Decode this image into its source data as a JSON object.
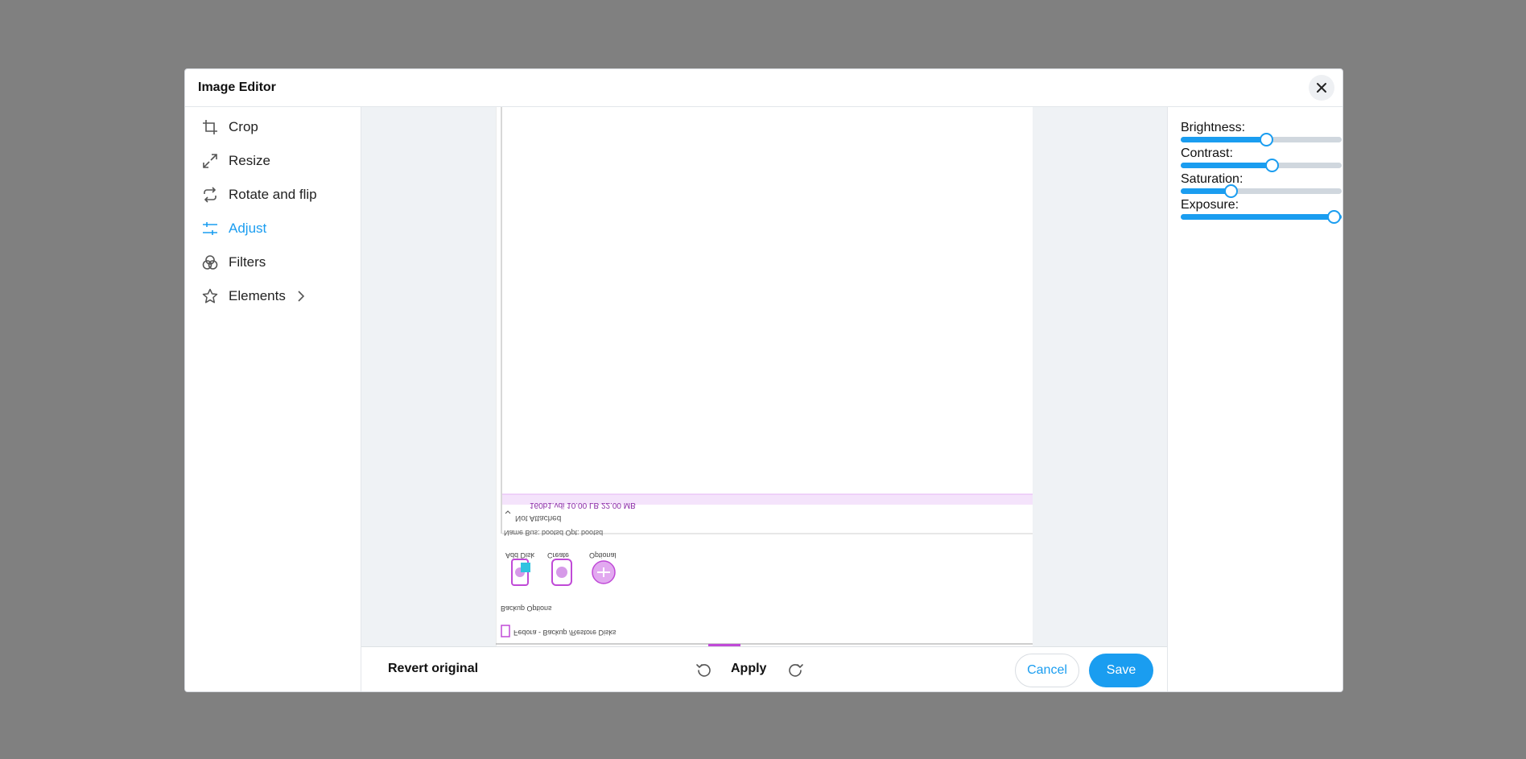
{
  "modal": {
    "title": "Image Editor"
  },
  "sidebar": {
    "items": [
      {
        "label": "Crop",
        "icon": "crop-icon",
        "active": false
      },
      {
        "label": "Resize",
        "icon": "resize-icon",
        "active": false
      },
      {
        "label": "Rotate and flip",
        "icon": "rotate-flip-icon",
        "active": false
      },
      {
        "label": "Adjust",
        "icon": "adjust-sliders-icon",
        "active": true
      },
      {
        "label": "Filters",
        "icon": "filters-icon",
        "active": false
      },
      {
        "label": "Elements",
        "icon": "star-icon",
        "active": false,
        "submenu": true
      }
    ]
  },
  "adjustments": [
    {
      "label": "Brightness:",
      "value": 0.53
    },
    {
      "label": "Contrast:",
      "value": 0.565
    },
    {
      "label": "Saturation:",
      "value": 0.31
    },
    {
      "label": "Exposure:",
      "value": 1.0
    }
  ],
  "footer": {
    "revert_label": "Revert original",
    "apply_label": "Apply",
    "cancel_label": "Cancel",
    "save_label": "Save"
  },
  "preview": {
    "row_1": "160b1.vdi   10.00 LB          22.00 MB",
    "row_2": "Not Attached",
    "cols": "Name          Bus: bootsd       Opt: bootsd",
    "icon_labels": [
      "Add Disk",
      "Create",
      "Optional"
    ],
    "section": "Backup Options",
    "footer_line": "Fedora - Backup /Restore Disks",
    "accent": "#e6b6f6",
    "icon_color": "#c04ad7",
    "highlight": "#31c3e0"
  },
  "colors": {
    "accent": "#1a9df0",
    "overlay": "#808080"
  }
}
